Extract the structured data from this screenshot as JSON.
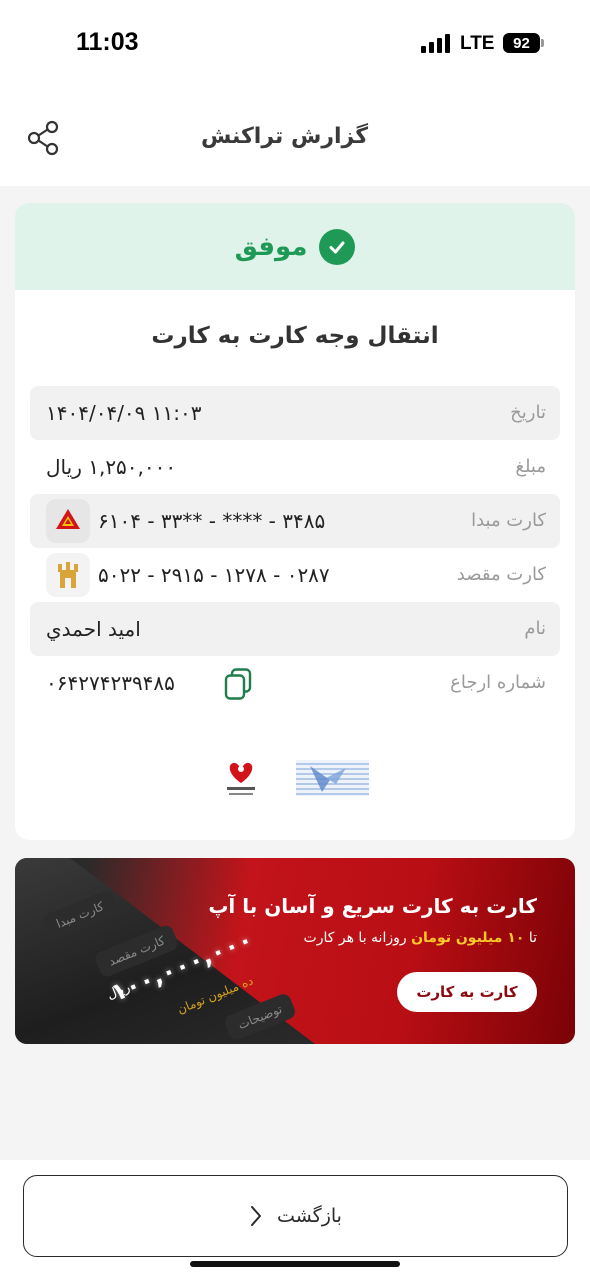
{
  "status_bar": {
    "time": "11:03",
    "network": "LTE",
    "battery": "92"
  },
  "header": {
    "title": "گزارش تراکنش",
    "share_icon": "share-icon"
  },
  "receipt": {
    "status": "موفق",
    "status_color": "#1e9a56",
    "banner_color": "#dff3ea",
    "title": "انتقال وجه کارت به کارت",
    "rows": [
      {
        "label": "تاریخ",
        "value": "۱۴۰۴/۰۴/۰۹ ۱۱:۰۳"
      },
      {
        "label": "مبلغ",
        "value": "۱,۲۵۰,۰۰۰ ریال"
      },
      {
        "label": "کارت مبدا",
        "value": "۶۱۰۴ - ۳۳** - **** - ۳۴۸۵",
        "bank_icon": "bank-mellat-icon"
      },
      {
        "label": "کارت مقصد",
        "value": "۵۰۲۲ - ۲۹۱۵ - ۱۲۷۸ - ۰۲۸۷",
        "bank_icon": "bank-pasargad-icon"
      },
      {
        "label": "نام",
        "value": "امید احمدي"
      },
      {
        "label": "شماره ارجاع",
        "value": "۰۶۴۲۷۴۲۳۹۴۸۵",
        "action_icon": "copy-icon"
      }
    ],
    "logos": [
      "shaparak-logo",
      "sep-logo"
    ]
  },
  "promo": {
    "title": "کارت به کارت سریع و آسان با آپ",
    "subtitle_prefix": "تا",
    "subtitle_highlight": "۱۰ میلیون تومان",
    "subtitle_suffix": "روزانه با هر کارت",
    "button": "کارت به کارت",
    "mock_amount": "۱۰۰,۰۰۰,۰۰۰",
    "mock_unit": "ریال",
    "mock_fields": [
      "کارت مبدا",
      "کارت مقصد",
      "توضیحات"
    ],
    "mock_hint": "ده میلیون تومان"
  },
  "footer": {
    "back_label": "بازگشت",
    "back_icon": "chevron-right-icon"
  }
}
